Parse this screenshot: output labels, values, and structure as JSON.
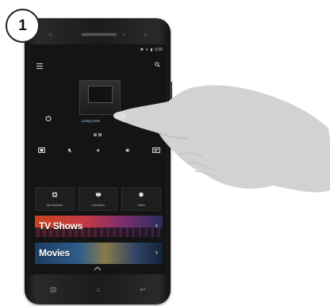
{
  "step": {
    "number": "1"
  },
  "status_bar": {
    "time": "5:00"
  },
  "activity": {
    "label": "Living room"
  },
  "tiles": [
    {
      "label": "My Watchlist",
      "icon": "watchlist-icon"
    },
    {
      "label": "Collections",
      "icon": "tv-icon"
    },
    {
      "label": "Offers",
      "icon": "offers-icon"
    }
  ],
  "banners": [
    {
      "title": "TV Shows",
      "arrow": "›"
    },
    {
      "title": "Movies",
      "arrow": "›"
    }
  ],
  "colors": {
    "accent": "#9fd8e6",
    "screen_bg": "#141414",
    "tv_banner": "#c8421d",
    "movies_banner": "#2f5d8a"
  }
}
